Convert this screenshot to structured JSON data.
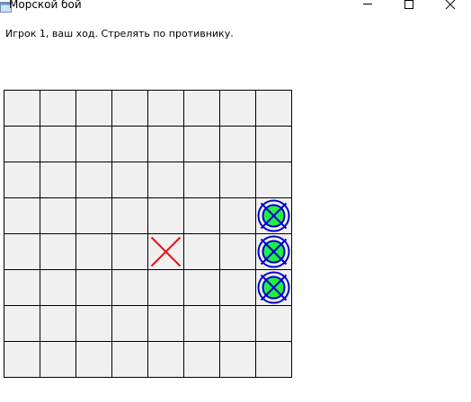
{
  "window": {
    "title": "Морской бой",
    "icon": "app-window-icon",
    "controls": [
      "minimize-icon",
      "maximize-icon",
      "close-icon"
    ]
  },
  "status": {
    "message": "Игрок 1, ваш ход. Стрелять по противнику."
  },
  "board": {
    "rows": 8,
    "cols": 8,
    "cell_color": "#f0f0f0",
    "grid_color": "#000000",
    "hit_fill": "#22ee44",
    "hit_ring": "#0000cc",
    "miss_color": "#ee1111",
    "misses": [
      {
        "row": 4,
        "col": 4
      }
    ],
    "hits": [
      {
        "row": 3,
        "col": 7
      },
      {
        "row": 4,
        "col": 7
      },
      {
        "row": 5,
        "col": 7
      }
    ]
  }
}
